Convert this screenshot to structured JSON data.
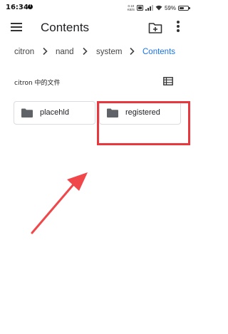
{
  "status_bar": {
    "time": "16:34",
    "notification_badge": "!",
    "net_speed_value": "0.10",
    "net_speed_unit": "KB/S",
    "battery_percent": "59%",
    "battery_level": 0.59
  },
  "app_bar": {
    "title": "Contents"
  },
  "breadcrumb": {
    "items": [
      "citron",
      "nand",
      "system",
      "Contents"
    ],
    "active_color": "#1a73e8"
  },
  "section": {
    "label": "citron 中的文件"
  },
  "folders": [
    {
      "name": "placehld",
      "icon": "folder-icon"
    },
    {
      "name": "registered",
      "icon": "folder-icon"
    }
  ],
  "annotation": {
    "color": "#e8383d",
    "highlighted_item": "registered"
  }
}
